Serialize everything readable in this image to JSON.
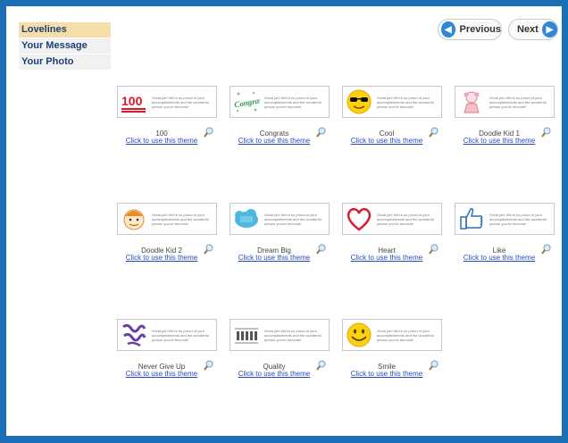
{
  "sidebar": {
    "items": [
      {
        "label": "Lovelines",
        "active": true
      },
      {
        "label": "Your Message",
        "active": false
      },
      {
        "label": "Your Photo",
        "active": false
      }
    ]
  },
  "nav": {
    "previous_label": "Previous",
    "next_label": "Next",
    "previous_icon": "arrow-left-circle-icon",
    "next_icon": "arrow-right-circle-icon"
  },
  "thumbnail_message": "Great job! We're so proud of your accomplishments and the wonderful person you've become!",
  "use_theme_label": "Click to use this theme",
  "themes": [
    {
      "name": "100",
      "icon": "hundred-emoji-icon"
    },
    {
      "name": "Congrats",
      "icon": "congrats-lettering-icon"
    },
    {
      "name": "Cool",
      "icon": "sunglasses-emoji-icon"
    },
    {
      "name": "Doodle Kid 1",
      "icon": "doodle-girl-icon"
    },
    {
      "name": "Doodle Kid 2",
      "icon": "doodle-boy-icon"
    },
    {
      "name": "Dream Big",
      "icon": "dream-big-icon"
    },
    {
      "name": "Heart",
      "icon": "heart-icon"
    },
    {
      "name": "Like",
      "icon": "thumbs-up-icon"
    },
    {
      "name": "Never Give Up",
      "icon": "never-give-up-icon"
    },
    {
      "name": "Quality",
      "icon": "quality-stamp-icon"
    },
    {
      "name": "Smile",
      "icon": "smiley-face-icon"
    }
  ],
  "colors": {
    "frame_blue": "#1a6fb5",
    "active_tab": "#f6deaa",
    "link_blue": "#2549c4",
    "button_blue": "#2f87d6"
  }
}
